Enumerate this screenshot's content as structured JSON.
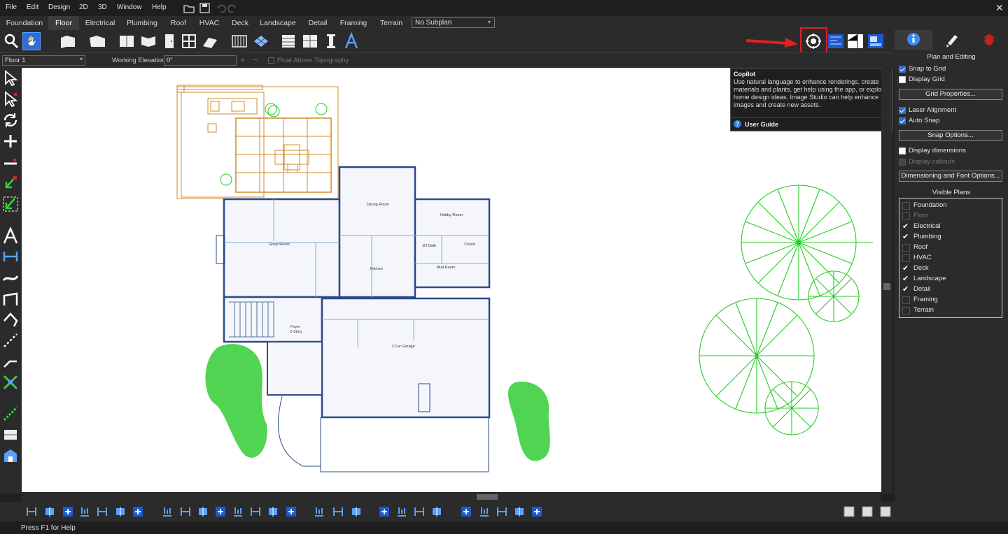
{
  "menu": [
    "File",
    "Edit",
    "Design",
    "2D",
    "3D",
    "Window",
    "Help"
  ],
  "tabs": [
    "Foundation",
    "Floor",
    "Electrical",
    "Plumbing",
    "Roof",
    "HVAC",
    "Deck",
    "Landscape",
    "Detail",
    "Framing",
    "Terrain"
  ],
  "active_tab": "Floor",
  "subplan": "No Subplan",
  "floor_select": "Floor 1",
  "working_elevation_label": "Working Elevation:",
  "working_elevation_value": "0\"",
  "float_topo_label": "Float Above Topography",
  "tooltip": {
    "title": "Copilot",
    "body": "Use natural language to enhance renderings, create materials and plants, get help using the app, or explore home design ideas. Image Studio can help enhance images and create new assets.",
    "guide": "User Guide",
    "help_glyph": "?"
  },
  "panel": {
    "heading": "Plan and Editing",
    "snap_to_grid": "Snap to Grid",
    "display_grid": "Display Grid",
    "grid_properties": "Grid Properties...",
    "laser_alignment": "Laser Alignment",
    "auto_snap": "Auto Snap",
    "snap_options": "Snap Options...",
    "display_dimensions": "Display dimensions",
    "display_callouts": "Display callouts",
    "dim_font_options": "Dimensioning and Font Options...",
    "visible_plans_heading": "Visible Plans",
    "visible_plans": [
      {
        "label": "Foundation",
        "checked": false,
        "dim": false
      },
      {
        "label": "Floor",
        "checked": false,
        "dim": true
      },
      {
        "label": "Electrical",
        "checked": true,
        "dim": false
      },
      {
        "label": "Plumbing",
        "checked": true,
        "dim": false
      },
      {
        "label": "Roof",
        "checked": false,
        "dim": false
      },
      {
        "label": "HVAC",
        "checked": false,
        "dim": false
      },
      {
        "label": "Deck",
        "checked": true,
        "dim": false
      },
      {
        "label": "Landscape",
        "checked": true,
        "dim": false
      },
      {
        "label": "Detail",
        "checked": true,
        "dim": false
      },
      {
        "label": "Framing",
        "checked": false,
        "dim": false
      },
      {
        "label": "Terrain",
        "checked": false,
        "dim": false
      }
    ]
  },
  "rooms": {
    "great_room": "Great Room",
    "dining_room": "Dining Room",
    "hobby_room": "Hobby Room",
    "half_bath": "1/2 Bath",
    "closet": "Closet",
    "mud_room": "Mud Room",
    "kitchen": "Kitchen",
    "foyer": "Foyer",
    "foyer2": "2-Story",
    "garage": "3 Car Garage"
  },
  "status": "Press F1 for Help",
  "colors": {
    "accent": "#2d6fd8",
    "highlight": "#e02020",
    "plant": "#22cc22",
    "deck": "#d08a2a",
    "wall": "#2b4a8a"
  }
}
